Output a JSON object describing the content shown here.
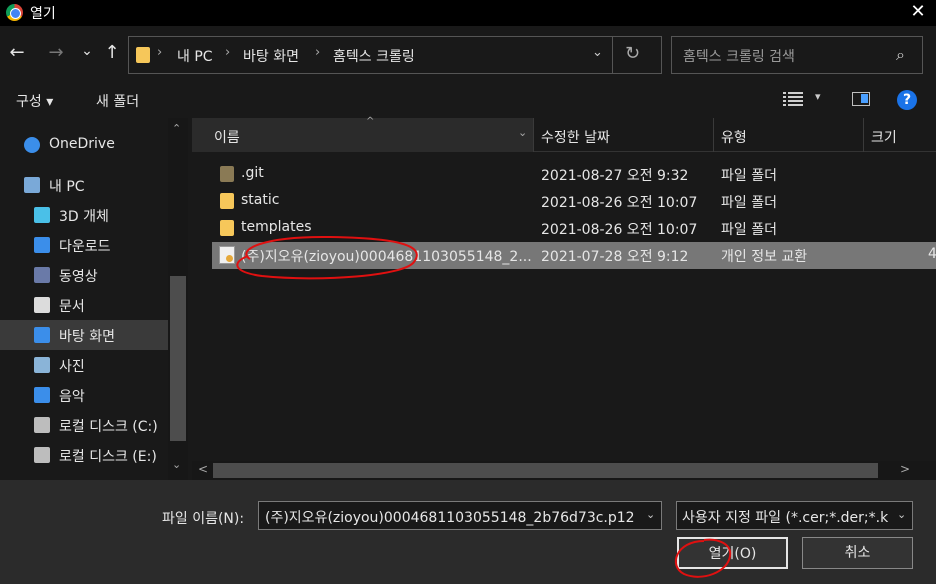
{
  "window": {
    "title": "열기",
    "close_glyph": "✕"
  },
  "nav": {
    "back_glyph": "←",
    "forward_glyph": "→",
    "recent_glyph": "⌄",
    "up_glyph": "↑",
    "breadcrumbs": [
      "내 PC",
      "바탕 화면",
      "홈텍스 크롤링"
    ],
    "breadcrumb_sep": "›",
    "address_dropdown_glyph": "⌄",
    "refresh_glyph": "↻",
    "search_placeholder": "홈텍스 크롤링 검색",
    "search_icon": "⌕"
  },
  "toolbar": {
    "organize": "구성 ▾",
    "new_folder": "새 폴더",
    "view_dropdown": "▾",
    "help": "?"
  },
  "sidebar": {
    "items": [
      {
        "label": "OneDrive",
        "icon": "cloud-icon",
        "color": "#3b8eea"
      },
      {
        "label": "내 PC",
        "icon": "pc-icon",
        "color": "#7aa9d8"
      },
      {
        "label": "3D 개체",
        "icon": "cube-icon",
        "color": "#4ac0e8"
      },
      {
        "label": "다운로드",
        "icon": "download-icon",
        "color": "#3b8eea"
      },
      {
        "label": "동영상",
        "icon": "film-icon",
        "color": "#6a7aa8"
      },
      {
        "label": "문서",
        "icon": "document-icon",
        "color": "#dcdcdc"
      },
      {
        "label": "바탕 화면",
        "icon": "desktop-icon",
        "color": "#3b8eea"
      },
      {
        "label": "사진",
        "icon": "photo-icon",
        "color": "#8ab4d8"
      },
      {
        "label": "음악",
        "icon": "music-icon",
        "color": "#3b8eea"
      },
      {
        "label": "로컬 디스크 (C:)",
        "icon": "disk-c-icon",
        "color": "#bdbdbd"
      },
      {
        "label": "로컬 디스크 (E:)",
        "icon": "disk-e-icon",
        "color": "#bdbdbd"
      }
    ],
    "selected_index": 6,
    "scroll_up": "⌃",
    "scroll_down": "⌄"
  },
  "list": {
    "columns": [
      "이름",
      "수정한 날짜",
      "유형",
      "크기"
    ],
    "sort_arrow": "^",
    "name_dropdown": "⌄",
    "rows": [
      {
        "name": ".git",
        "date": "2021-08-27 오전 9:32",
        "type": "파일 폴더",
        "size": "",
        "kind": "folder-git"
      },
      {
        "name": "static",
        "date": "2021-08-26 오전 10:07",
        "type": "파일 폴더",
        "size": "",
        "kind": "folder"
      },
      {
        "name": "templates",
        "date": "2021-08-26 오전 10:07",
        "type": "파일 폴더",
        "size": "",
        "kind": "folder"
      },
      {
        "name": "(주)지오유(zioyou)0004681103055148_2...",
        "date": "2021-07-28 오전 9:12",
        "type": "개인 정보 교환",
        "size": "4",
        "kind": "cert"
      }
    ],
    "selected_index": 3,
    "hscroll_left": "<",
    "hscroll_right": ">"
  },
  "footer": {
    "filename_label": "파일 이름(N):",
    "filename_value": "(주)지오유(zioyou)0004681103055148_2b76d73c.p12",
    "filename_dropdown": "⌄",
    "filter_value": "사용자 지정 파일 (*.cer;*.der;*.k",
    "filter_dropdown": "⌄",
    "open_button": "열기(O)",
    "cancel_button": "취소"
  },
  "colors": {
    "annotation": "#e01010",
    "folder": "#f6c75a",
    "selected_row": "#777777"
  }
}
